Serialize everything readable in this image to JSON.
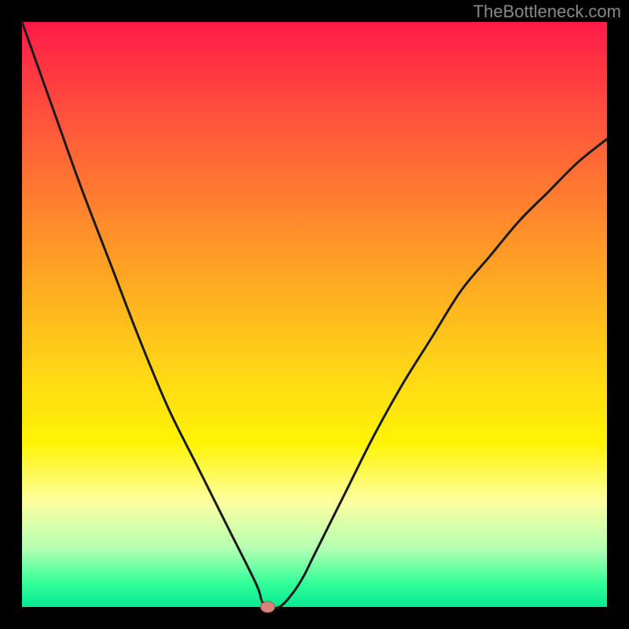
{
  "watermark": "TheBottleneck.com",
  "chart_data": {
    "type": "line",
    "title": "",
    "xlabel": "",
    "ylabel": "",
    "xlim": [
      0,
      100
    ],
    "ylim": [
      0,
      100
    ],
    "x": [
      0,
      5,
      10,
      15,
      20,
      25,
      30,
      35,
      40,
      41,
      42,
      44,
      46,
      48,
      50,
      55,
      60,
      65,
      70,
      75,
      80,
      85,
      90,
      95,
      100
    ],
    "y": [
      100,
      86,
      72,
      59,
      46,
      34,
      24,
      14,
      4,
      1,
      0,
      0,
      2,
      5,
      9,
      19,
      29,
      38,
      46,
      54,
      60,
      66,
      71,
      76,
      80
    ],
    "marker": {
      "x": 42,
      "y": 0
    },
    "gradient_stops": [
      {
        "offset": 0.0,
        "color": "#ff1b48"
      },
      {
        "offset": 0.2,
        "color": "#ff5e39"
      },
      {
        "offset": 0.4,
        "color": "#ff9c26"
      },
      {
        "offset": 0.6,
        "color": "#ffd716"
      },
      {
        "offset": 0.72,
        "color": "#fff406"
      },
      {
        "offset": 0.82,
        "color": "#fdffa1"
      },
      {
        "offset": 0.9,
        "color": "#b4ffb3"
      },
      {
        "offset": 0.96,
        "color": "#31ff99"
      },
      {
        "offset": 1.0,
        "color": "#06e893"
      }
    ],
    "frame_color": "#000000",
    "frame_thickness": 28,
    "curve_color": "#1a1a1a",
    "curve_width": 3,
    "marker_fill": "#d6837a",
    "marker_stroke": "#9a5a55"
  }
}
